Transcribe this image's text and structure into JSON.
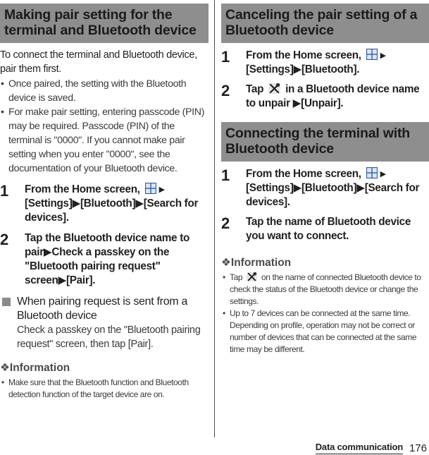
{
  "left": {
    "heading": "Making pair setting for the terminal and Bluetooth device",
    "intro": "To connect the terminal and Bluetooth device, pair them first.",
    "bullets": [
      "Once paired, the setting with the Bluetooth device is saved.",
      "For make pair setting, entering passcode (PIN) may be required. Passcode (PIN) of the terminal is \"0000\". If you cannot make pair setting when you enter \"0000\", see the documentation of your Bluetooth device."
    ],
    "steps": [
      {
        "num": "1",
        "pre": "From the Home screen,",
        "post": "[Settings]▶[Bluetooth]▶[Search for devices].",
        "icon": "home-grid-icon"
      },
      {
        "num": "2",
        "text": "Tap the Bluetooth device name to pair▶Check a passkey on the \"Bluetooth pairing request\" screen▶[Pair]."
      }
    ],
    "subsection": {
      "title": "When pairing request is sent from a Bluetooth device",
      "body": "Check a passkey on the \"Bluetooth pairing request\" screen, then tap [Pair]."
    },
    "information": {
      "mark": "❖",
      "title": "Information",
      "items": [
        "Make sure that the Bluetooth function and Bluetooth detection function of the target device are on."
      ]
    }
  },
  "right": {
    "cancel": {
      "heading": "Canceling the pair setting of a Bluetooth device",
      "steps": [
        {
          "num": "1",
          "pre": "From the Home screen,",
          "post": "[Settings]▶[Bluetooth].",
          "icon": "home-grid-icon"
        },
        {
          "num": "2",
          "pre": "Tap",
          "post": "in a Bluetooth device name to unpair ▶[Unpair].",
          "icon": "settings-tool-icon"
        }
      ]
    },
    "connect": {
      "heading": "Connecting the terminal with Bluetooth device",
      "steps": [
        {
          "num": "1",
          "pre": "From the Home screen,",
          "post": "[Settings]▶[Bluetooth]▶[Search for devices].",
          "icon": "home-grid-icon"
        },
        {
          "num": "2",
          "text": "Tap the name of Bluetooth device you want to connect."
        }
      ]
    },
    "information": {
      "mark": "❖",
      "title": "Information",
      "items": [
        {
          "pre": "Tap",
          "post": "on the name of connected Bluetooth device to check the status of the Bluetooth device or change the settings.",
          "icon": "settings-tool-icon"
        },
        {
          "text": "Up to 7 devices can be connected at the same time. Depending on profile, operation may not be correct or number of devices that can be connected at the same time may be different."
        }
      ]
    }
  },
  "footer": {
    "section": "Data communication",
    "page": "176"
  },
  "colors": {
    "heading_bg": "#8e8e8e",
    "home_icon_blue": "#2a5db0"
  },
  "glyphs": {
    "arrow": "▶",
    "bullet": "•"
  }
}
